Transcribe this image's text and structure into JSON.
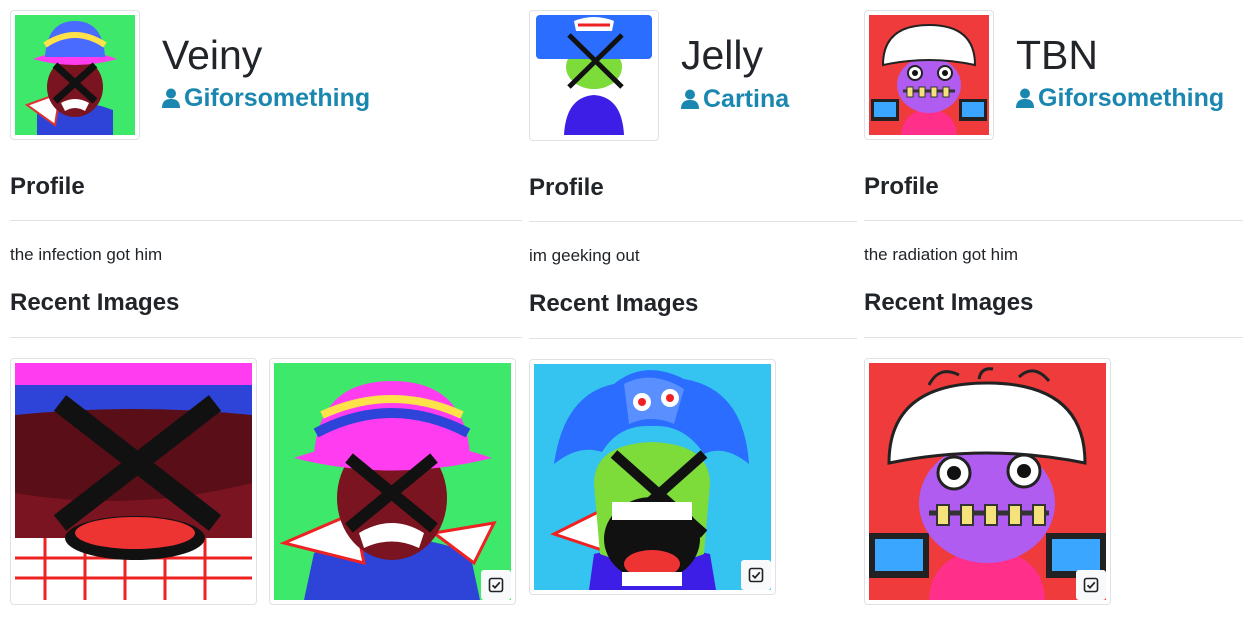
{
  "profiles": [
    {
      "name": "Veiny",
      "owner": "Giforsomething",
      "profile_heading": "Profile",
      "description": "the infection got him",
      "recent_heading": "Recent Images",
      "colors": {
        "background": "#3ee86a",
        "hat": "#ff3cf0",
        "band": "#2e44d9"
      }
    },
    {
      "name": "Jelly",
      "owner": "Cartina",
      "profile_heading": "Profile",
      "description": "im geeking out",
      "recent_heading": "Recent Images",
      "colors": {
        "background": "#35c3ef",
        "hat": "#2a6dff",
        "face": "#7ddc3a"
      }
    },
    {
      "name": "TBN",
      "owner": "Giforsomething",
      "profile_heading": "Profile",
      "description": "the radiation got him",
      "recent_heading": "Recent Images",
      "colors": {
        "background": "#ef3b3b",
        "hat": "#ffffff",
        "face": "#b05cf0"
      }
    }
  ],
  "icons": {
    "owner": "user-icon",
    "badge": "check-square-icon"
  }
}
